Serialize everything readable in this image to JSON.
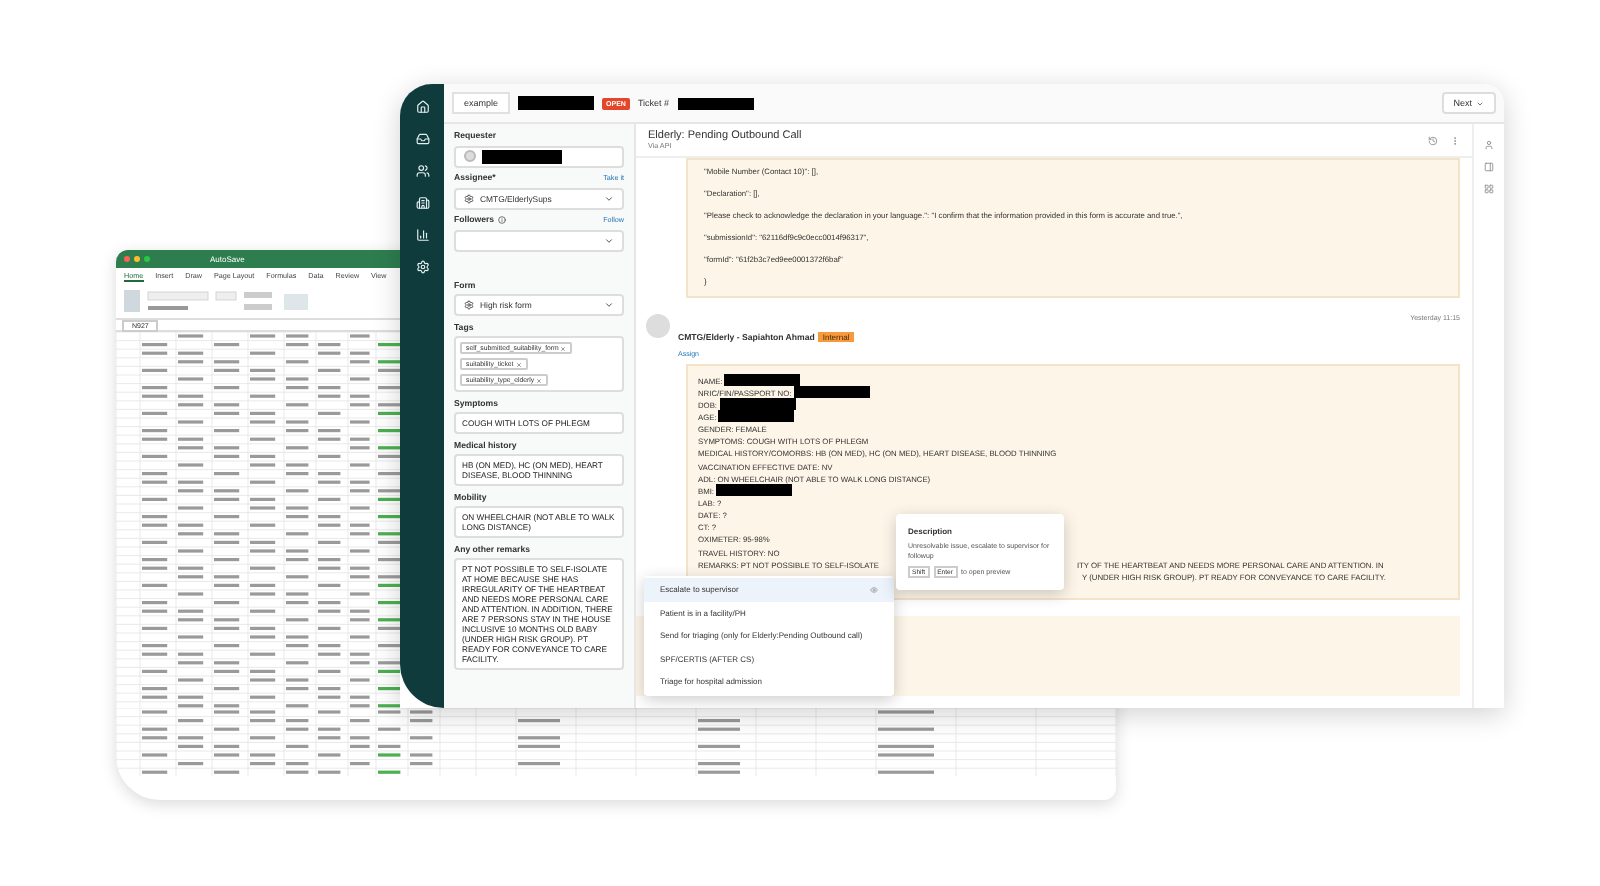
{
  "spreadsheet": {
    "title": "AutoSave",
    "cell_ref": "N927",
    "ribbon_tabs": [
      {
        "label": "Home",
        "selected": true
      },
      {
        "label": "Insert",
        "selected": false
      },
      {
        "label": "Draw",
        "selected": false
      },
      {
        "label": "Page Layout",
        "selected": false
      },
      {
        "label": "Formulas",
        "selected": false
      },
      {
        "label": "Data",
        "selected": false
      },
      {
        "label": "Review",
        "selected": false
      },
      {
        "label": "View",
        "selected": false
      }
    ]
  },
  "ticket": {
    "tab_label": "example",
    "tab_redacted": true,
    "status_badge": "OPEN",
    "ticket_label": "Ticket #",
    "ticket_redacted": true,
    "next_button": "Next",
    "fields": [
      {
        "label": "Requester",
        "kind": "person",
        "redacted": true,
        "info": false
      },
      {
        "label": "Assignee*",
        "action": "Take it",
        "kind": "select",
        "value": "CMTG/ElderlySups",
        "info": false
      },
      {
        "label": "Followers",
        "action": "Follow",
        "kind": "select",
        "info": true
      }
    ],
    "form_fields": [
      {
        "label": "Form",
        "kind": "select",
        "value": "High risk form"
      },
      {
        "label": "Tags",
        "kind": "tags",
        "tags": [
          "self_submitted_suitability_form",
          "suitability_ticket",
          "suitability_type_elderly"
        ]
      },
      {
        "label": "Symptoms",
        "kind": "text",
        "value": "COUGH WITH LOTS OF PHLEGM"
      },
      {
        "label": "Medical history",
        "kind": "text",
        "value": "HB (ON MED), HC (ON MED), HEART DISEASE, BLOOD THINNING"
      },
      {
        "label": "Mobility",
        "kind": "text",
        "value": "ON WHEELCHAIR (NOT ABLE TO WALK LONG DISTANCE)"
      },
      {
        "label": "Any other remarks",
        "kind": "text",
        "value": "PT NOT POSSIBLE TO SELF-ISOLATE AT HOME BECAUSE SHE HAS IRREGULARITY OF THE HEARTBEAT AND NEEDS MORE PERSONAL CARE AND ATTENTION.  IN ADDITION, THERE ARE 7 PERSONS STAY IN THE HOUSE INCLUSIVE 10 MONTHS OLD BABY (UNDER HIGH RISK GROUP).  PT READY FOR CONVEYANCE TO CARE FACILITY."
      }
    ],
    "title": "Elderly: Pending Outbound Call",
    "channel": "Via API",
    "first_message": [
      "\"Mobile Number (Contact 10)\": [],",
      "\"Declaration\": [],",
      "\"Please check to acknowledge the declaration in your language.\": \"I confirm that the information provided in this form is accurate and true.\",",
      "\"submissionId\": \"62116df9c9c0ecc0014f96317\",",
      "\"formId\": \"61f2b3c7ed9ee0001372f6baf\"",
      "}"
    ],
    "second_message": {
      "author": "CMTG/Elderly - Sapiahton Ahmad",
      "badge": "Internal",
      "assign": "Assign",
      "time": "Yesterday 11:15",
      "lines": [
        {
          "text": "NAME:",
          "redacted": true
        },
        {
          "text": "NRIC/FIN/PASSPORT NO:",
          "redacted": true
        },
        {
          "text": "DOB:",
          "redacted": true
        },
        {
          "text": "AGE:",
          "redacted": true
        },
        {
          "text": "GENDER: FEMALE",
          "redacted": false
        },
        {
          "text": "SYMPTOMS: COUGH WITH LOTS OF PHLEGM",
          "redacted": false
        },
        {
          "text": "MEDICAL HISTORY/COMORBS: HB (ON MED), HC (ON MED), HEART DISEASE, BLOOD THINNING",
          "redacted": false
        },
        {
          "text": "VACCINATION EFFECTIVE DATE: NV",
          "redacted": false
        },
        {
          "text": "ADL: ON WHEELCHAIR (NOT ABLE TO WALK LONG DISTANCE)",
          "redacted": false
        },
        {
          "text": "BMI:",
          "redacted": true
        },
        {
          "text": "LAB: ?",
          "redacted": false
        },
        {
          "text": "DATE: ?",
          "redacted": false
        },
        {
          "text": "CT: ?",
          "redacted": false
        },
        {
          "text": "OXIMETER: 95-98%",
          "redacted": false
        },
        {
          "text": "TRAVEL HISTORY: NO",
          "redacted": false
        }
      ],
      "remarks_fragments": [
        "REMARKS: PT NOT POSSIBLE TO SELF-ISOLATE",
        "ITY OF THE HEARTBEAT AND NEEDS MORE PERSONAL CARE AND ATTENTION.  IN",
        "Y (UNDER HIGH RISK GROUP).  PT READY FOR CONVEYANCE TO CARE FACILITY."
      ]
    },
    "macro_menu": [
      {
        "label": "Escalate to supervisor",
        "selected": true
      },
      {
        "label": "Patient is in a facility/PH",
        "selected": false
      },
      {
        "label": "Send for triaging (only for Elderly:Pending Outbound call)",
        "selected": false
      },
      {
        "label": "SPF/CERTIS (AFTER CS)",
        "selected": false
      },
      {
        "label": "Triage for hospital admission",
        "selected": false
      }
    ],
    "tooltip": {
      "title": "Description",
      "text": "Unresolvable issue, escalate to supervisor for followup",
      "keys": [
        "Shift",
        "Enter"
      ],
      "hint": "to open preview"
    }
  }
}
